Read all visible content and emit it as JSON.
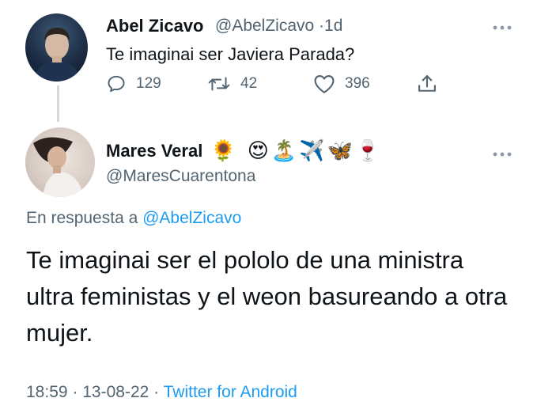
{
  "parent_tweet": {
    "author_name": "Abel Zicavo",
    "author_handle": "@AbelZicavo",
    "separator": "·",
    "time_ago": "1d",
    "text": "Te imaginai ser Javiera Parada?",
    "reply_count": "129",
    "retweet_count": "42",
    "like_count": "396",
    "icons": {
      "reply": "reply-bubble-icon",
      "retweet": "retweet-icon",
      "like": "heart-icon",
      "share": "share-icon",
      "more": "more-dots-icon"
    }
  },
  "reply_tweet": {
    "author_name": "Mares Veral",
    "author_emojis": [
      "🌻",
      "😍",
      "🏝️",
      "✈️",
      "🦋",
      "🍷"
    ],
    "author_handle": "@MaresCuarentona",
    "replying_prefix": "En respuesta a",
    "replying_to": "@AbelZicavo",
    "text": "Te imaginai ser el pololo de una ministra ultra feministas y el weon basureando a otra mujer.",
    "time": "18:59",
    "separator": "·",
    "date": "13-08-22",
    "source": "Twitter for Android"
  },
  "colors": {
    "text_primary": "#0f1419",
    "text_secondary": "#536471",
    "link": "#1d9bf0",
    "thread_line": "#cfd9de"
  }
}
